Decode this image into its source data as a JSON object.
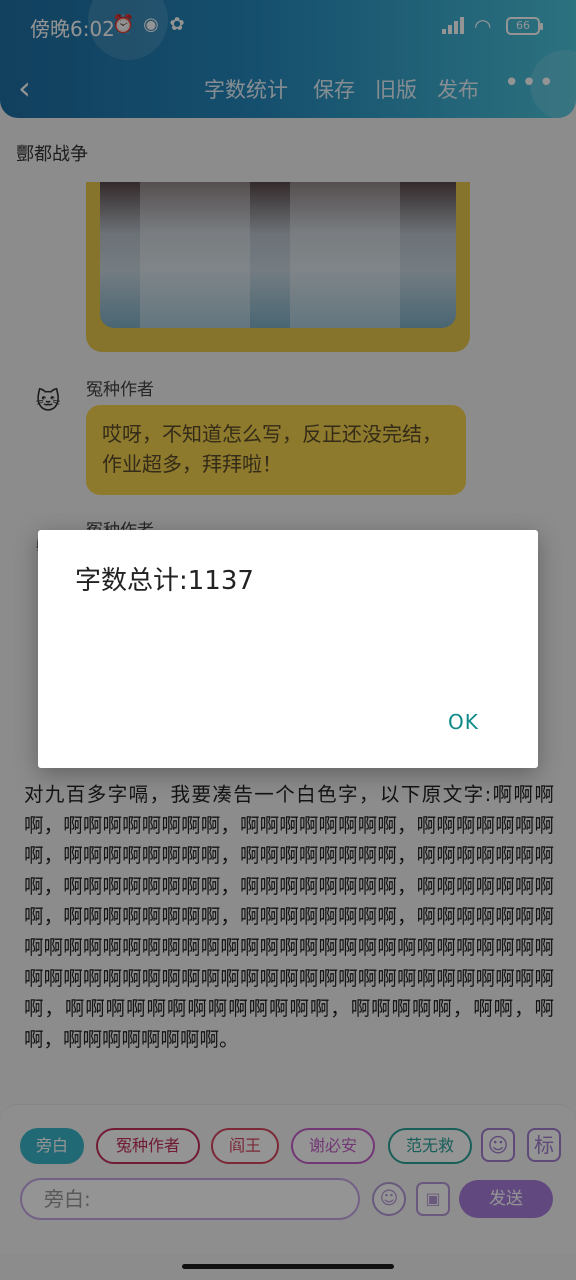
{
  "status_bar": {
    "time": "傍晚6:02",
    "battery": "66",
    "icons": [
      "alarm-icon",
      "app-notification-icon",
      "flower-icon",
      "signal-icon",
      "wifi-icon",
      "battery-icon"
    ]
  },
  "navbar": {
    "back_icon": "chevron-left-icon",
    "actions": [
      "字数统计",
      "保存",
      "旧版",
      "发布"
    ],
    "more": "•••"
  },
  "document": {
    "title": "酆都战争",
    "messages": [
      {
        "author": "冤种作者",
        "text": "哎呀，不知道怎么写，反正还没完结，作业超多，拜拜啦！"
      },
      {
        "author": "冤种作者"
      }
    ],
    "narration": "对九百多字嗝，我要凑告一个白色字，以下原文字:啊啊啊啊，啊啊啊啊啊啊啊啊，啊啊啊啊啊啊啊啊，啊啊啊啊啊啊啊啊，啊啊啊啊啊啊啊啊，啊啊啊啊啊啊啊啊，啊啊啊啊啊啊啊啊，啊啊啊啊啊啊啊啊，啊啊啊啊啊啊啊啊，啊啊啊啊啊啊啊啊，啊啊啊啊啊啊啊啊，啊啊啊啊啊啊啊啊，啊啊啊啊啊啊啊啊啊啊啊啊啊啊啊啊啊啊啊啊啊啊啊啊啊啊啊啊啊啊啊啊啊啊啊啊啊啊啊啊啊啊啊啊啊啊啊啊啊啊啊啊啊啊啊啊啊啊啊啊啊啊，啊啊啊啊啊啊啊啊啊啊啊啊啊，啊啊啊啊啊，啊啊，啊啊，啊啊啊啊啊啊啊啊。"
  },
  "input_panel": {
    "characters": [
      {
        "label": "旁白",
        "color": "#3ab6c9",
        "active": true
      },
      {
        "label": "冤种作者",
        "color": "#c0315a"
      },
      {
        "label": "阎王",
        "color": "#d6455e"
      },
      {
        "label": "谢必安",
        "color": "#c560c9"
      },
      {
        "label": "范无救",
        "color": "#2aa39a"
      }
    ],
    "person_icon": "person-icon",
    "tag_label": "标",
    "placeholder": "旁白:",
    "emoji_icon": "smile-icon",
    "image_icon": "image-icon",
    "send_label": "发送"
  },
  "dialog": {
    "message": "字数总计:1137",
    "ok_label": "OK"
  },
  "colors": {
    "header_start": "#1e6fa3",
    "header_end": "#4cc4db",
    "bubble": "#f4d24e",
    "accent_purple": "#a87fdc",
    "ok_teal": "#0f8a8a"
  }
}
